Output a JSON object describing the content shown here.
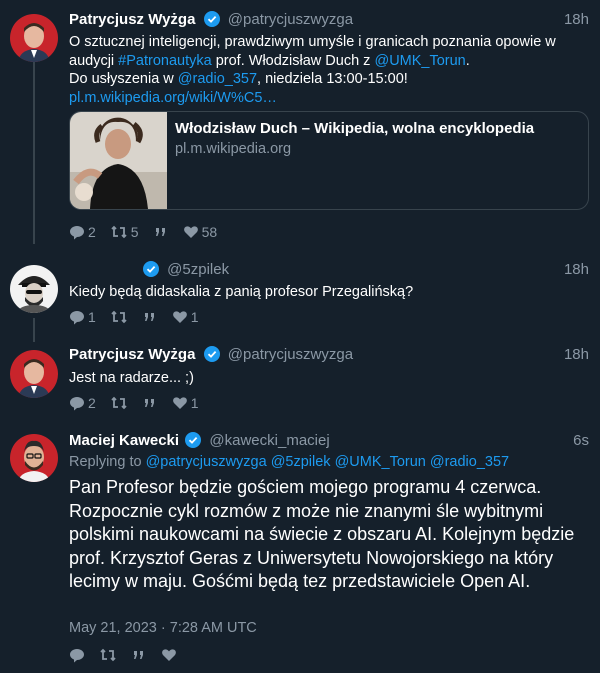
{
  "tweets": [
    {
      "name": "Patrycjusz Wyżga",
      "handle": "@patrycjuszwyzga",
      "time": "18h",
      "text_pre": "O sztucznej inteligencji, prawdziwym umyśle i granicach poznania opowie w audycji ",
      "hashtag": "#Patronautyka",
      "text_mid": " prof. Włodzisław Duch z ",
      "mention1": "@UMK_Torun",
      "text_end": ".",
      "line2_pre": "Do usłyszenia w ",
      "mention2": "@radio_357",
      "line2_post": ", niedziela 13:00-15:00!",
      "link": "pl.m.wikipedia.org/wiki/W%C5…",
      "card": {
        "title": "Włodzisław Duch – Wikipedia, wolna encyklopedia",
        "domain": "pl.m.wikipedia.org"
      },
      "replies": "2",
      "retweets": "5",
      "likes": "58"
    },
    {
      "name": "",
      "handle": "@5zpilek",
      "time": "18h",
      "text": "Kiedy będą didaskalia z panią profesor Przegalińską?",
      "replies": "1",
      "likes": "1"
    },
    {
      "name": "Patrycjusz Wyżga",
      "handle": "@patrycjuszwyzga",
      "time": "18h",
      "text": "Jest na radarze... ;)",
      "replies": "2",
      "likes": "1"
    },
    {
      "name": "Maciej Kawecki",
      "handle": "@kawecki_maciej",
      "time": "6s",
      "replying_label": "Replying to",
      "replying_to": "@patrycjuszwyzga @5zpilek @UMK_Torun @radio_357",
      "text": "Pan Profesor będzie gościem mojego programu 4 czerwca. Rozpocznie cykl rozmów z może nie znanymi śle wybitnymi polskimi naukowcami na świecie z obszaru AI. Kolejnym będzie prof. Krzysztof Geras z Uniwersytetu Nowojorskiego na który lecimy w maju. Gośćmi będą tez przedstawiciele Open AI.",
      "date": "May 21, 2023 · 7:28 AM UTC"
    }
  ],
  "colors": {
    "background": "#15202b",
    "link": "#1d9bf0",
    "muted": "#8b98a5",
    "line": "#38444d"
  }
}
